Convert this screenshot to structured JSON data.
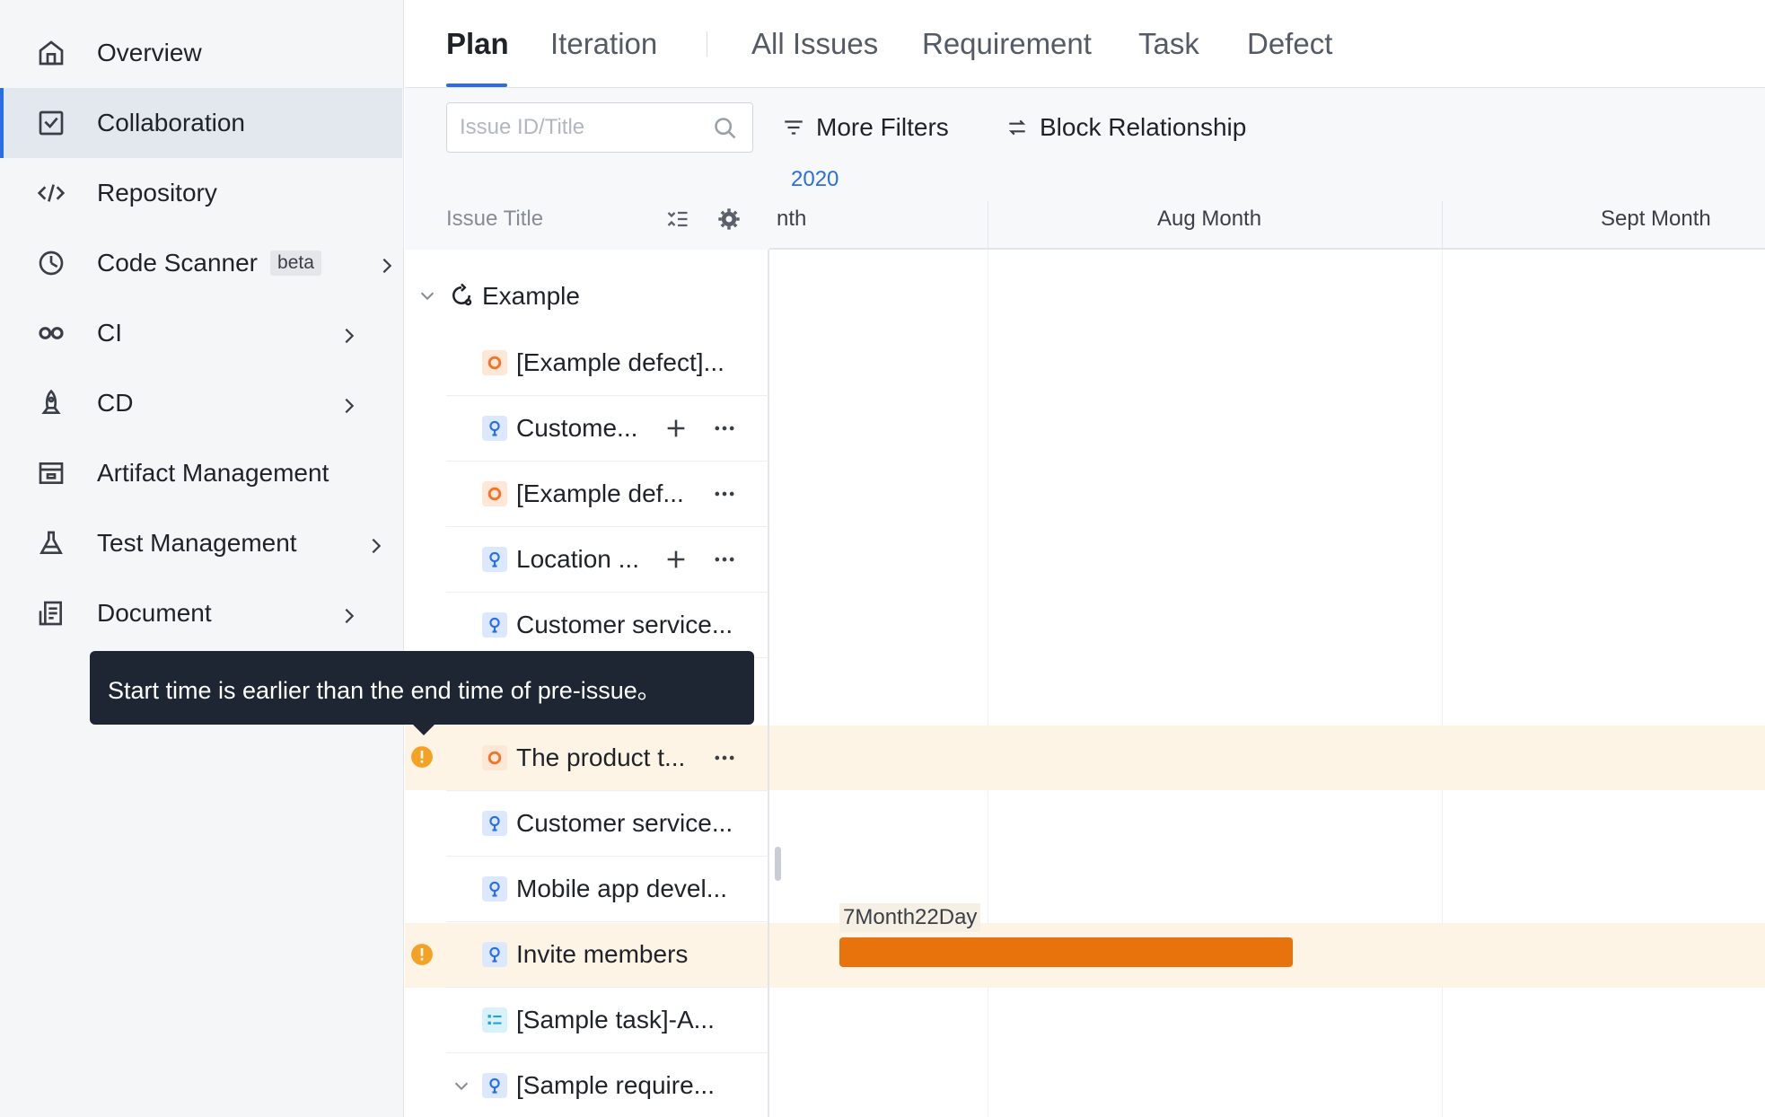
{
  "sidebar": {
    "items": [
      {
        "label": "Overview",
        "icon": "home-icon"
      },
      {
        "label": "Collaboration",
        "icon": "checkbox-board-icon",
        "active": true
      },
      {
        "label": "Repository",
        "icon": "code-brackets-icon"
      },
      {
        "label": "Code Scanner",
        "icon": "scanner-icon",
        "badge": "beta",
        "has_children": true
      },
      {
        "label": "CI",
        "icon": "infinity-icon",
        "has_children": true
      },
      {
        "label": "CD",
        "icon": "rocket-icon",
        "has_children": true
      },
      {
        "label": "Artifact Management",
        "icon": "box-icon"
      },
      {
        "label": "Test Management",
        "icon": "flask-icon",
        "has_children": true
      },
      {
        "label": "Document",
        "icon": "document-icon",
        "has_children": true
      }
    ]
  },
  "tabs": [
    "Plan",
    "Iteration",
    "All Issues",
    "Requirement",
    "Task",
    "Defect"
  ],
  "active_tab": "Plan",
  "toolbar": {
    "search_placeholder": "Issue ID/Title",
    "search_value": "",
    "more_filters": "More Filters",
    "block_relationship": "Block Relationship"
  },
  "gantt": {
    "issue_header": "Issue Title",
    "year": "2020",
    "months": [
      "nth",
      "Aug Month",
      "Sept Month"
    ],
    "group": "Example",
    "rows": [
      {
        "type": "defect",
        "title": "[Example defect]..."
      },
      {
        "type": "requirement",
        "title": "Custome...",
        "actions": [
          "add",
          "more"
        ]
      },
      {
        "type": "defect",
        "title": "[Example def...",
        "actions": [
          "more"
        ]
      },
      {
        "type": "requirement",
        "title": "Location ...",
        "actions": [
          "add",
          "more"
        ]
      },
      {
        "type": "requirement",
        "title": "Customer service..."
      },
      {
        "type": "defect",
        "title": "The product t...",
        "actions": [
          "more"
        ],
        "warning": true
      },
      {
        "type": "requirement",
        "title": "Customer service..."
      },
      {
        "type": "requirement",
        "title": "Mobile app devel..."
      },
      {
        "type": "requirement",
        "title": "Invite members",
        "warning": true
      },
      {
        "type": "task",
        "title": "[Sample task]-A..."
      },
      {
        "type": "requirement",
        "title": "[Sample require...",
        "collapsible": true
      }
    ],
    "bar": {
      "label": "7Month22Day",
      "color": "#e8720c"
    }
  },
  "tooltip": "Start time is earlier than the end time of pre-issue。",
  "colors": {
    "accent": "#2a6ee6",
    "defect": "#f0742c",
    "requirement": "#2a6ee6",
    "task": "#1aa5d8",
    "warning": "#f4a225",
    "bar": "#e8720c"
  }
}
